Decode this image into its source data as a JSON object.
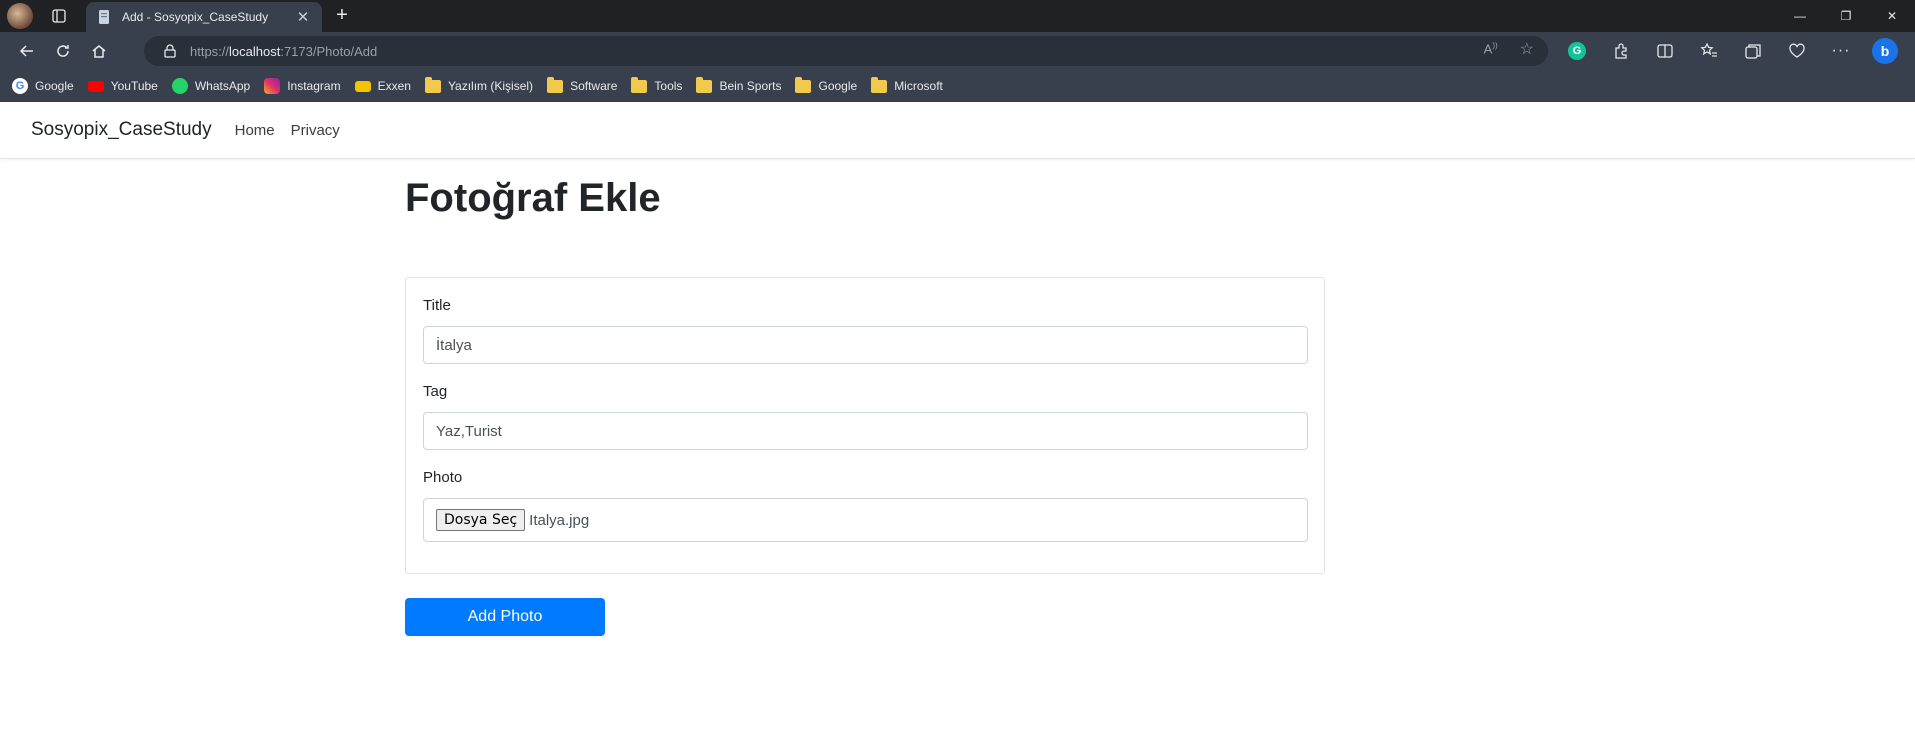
{
  "browser": {
    "tab_title": "Add - Sosyopix_CaseStudy",
    "url_prefix": "https://",
    "url_host": "localhost",
    "url_rest": ":7173/Photo/Add",
    "bookmarks": [
      {
        "label": "Google",
        "icon": "google-icon",
        "color": "#ffffff"
      },
      {
        "label": "YouTube",
        "icon": "youtube-icon",
        "color": "#ff0000"
      },
      {
        "label": "WhatsApp",
        "icon": "whatsapp-icon",
        "color": "#25d366"
      },
      {
        "label": "Instagram",
        "icon": "instagram-icon",
        "color": "#e1306c"
      },
      {
        "label": "Exxen",
        "icon": "exxen-icon",
        "color": "#f5c400"
      },
      {
        "label": "Yazılım (Kişisel)",
        "icon": "folder-icon"
      },
      {
        "label": "Software",
        "icon": "folder-icon"
      },
      {
        "label": "Tools",
        "icon": "folder-icon"
      },
      {
        "label": "Bein Sports",
        "icon": "folder-icon"
      },
      {
        "label": "Google",
        "icon": "folder-icon"
      },
      {
        "label": "Microsoft",
        "icon": "folder-icon"
      }
    ]
  },
  "navbar": {
    "brand": "Sosyopix_CaseStudy",
    "links": [
      "Home",
      "Privacy"
    ]
  },
  "page": {
    "title": "Fotoğraf Ekle"
  },
  "form": {
    "title_label": "Title",
    "title_value": "İtalya",
    "tag_label": "Tag",
    "tag_value": "Yaz,Turist",
    "photo_label": "Photo",
    "file_button": "Dosya Seç",
    "file_name": "Italya.jpg",
    "submit_label": "Add Photo"
  },
  "colors": {
    "primary": "#007bff",
    "chrome_dark": "#202124",
    "chrome_toolbar": "#37404c"
  }
}
